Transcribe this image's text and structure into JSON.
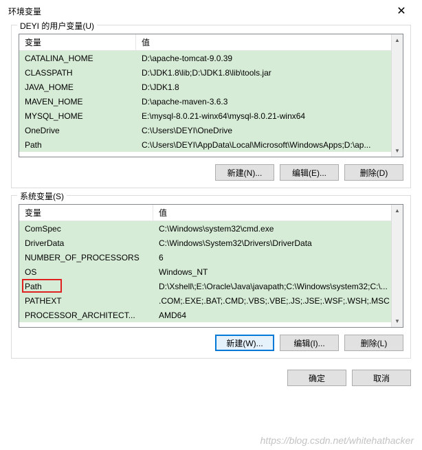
{
  "title": "环境变量",
  "user_vars": {
    "label": "DEYI 的用户变量(U)",
    "columns": {
      "name": "变量",
      "value": "值"
    },
    "rows": [
      {
        "name": "CATALINA_HOME",
        "value": "D:\\apache-tomcat-9.0.39"
      },
      {
        "name": "CLASSPATH",
        "value": "D:\\JDK1.8\\lib;D:\\JDK1.8\\lib\\tools.jar"
      },
      {
        "name": "JAVA_HOME",
        "value": "D:\\JDK1.8"
      },
      {
        "name": "MAVEN_HOME",
        "value": "D:\\apache-maven-3.6.3"
      },
      {
        "name": "MYSQL_HOME",
        "value": "E:\\mysql-8.0.21-winx64\\mysql-8.0.21-winx64"
      },
      {
        "name": "OneDrive",
        "value": "C:\\Users\\DEYI\\OneDrive"
      },
      {
        "name": "Path",
        "value": "C:\\Users\\DEYI\\AppData\\Local\\Microsoft\\WindowsApps;D:\\ap..."
      }
    ],
    "buttons": {
      "new": "新建(N)...",
      "edit": "编辑(E)...",
      "delete": "删除(D)"
    }
  },
  "system_vars": {
    "label": "系统变量(S)",
    "columns": {
      "name": "变量",
      "value": "值"
    },
    "rows": [
      {
        "name": "ComSpec",
        "value": "C:\\Windows\\system32\\cmd.exe"
      },
      {
        "name": "DriverData",
        "value": "C:\\Windows\\System32\\Drivers\\DriverData"
      },
      {
        "name": "NUMBER_OF_PROCESSORS",
        "value": "6"
      },
      {
        "name": "OS",
        "value": "Windows_NT"
      },
      {
        "name": "Path",
        "value": "D:\\Xshell\\;E:\\Oracle\\Java\\javapath;C:\\Windows\\system32;C:\\..."
      },
      {
        "name": "PATHEXT",
        "value": ".COM;.EXE;.BAT;.CMD;.VBS;.VBE;.JS;.JSE;.WSF;.WSH;.MSC"
      },
      {
        "name": "PROCESSOR_ARCHITECT...",
        "value": "AMD64"
      }
    ],
    "buttons": {
      "new": "新建(W)...",
      "edit": "编辑(I)...",
      "delete": "删除(L)"
    }
  },
  "dialog_buttons": {
    "ok": "确定",
    "cancel": "取消"
  },
  "watermark": "https://blog.csdn.net/whitehathacker"
}
